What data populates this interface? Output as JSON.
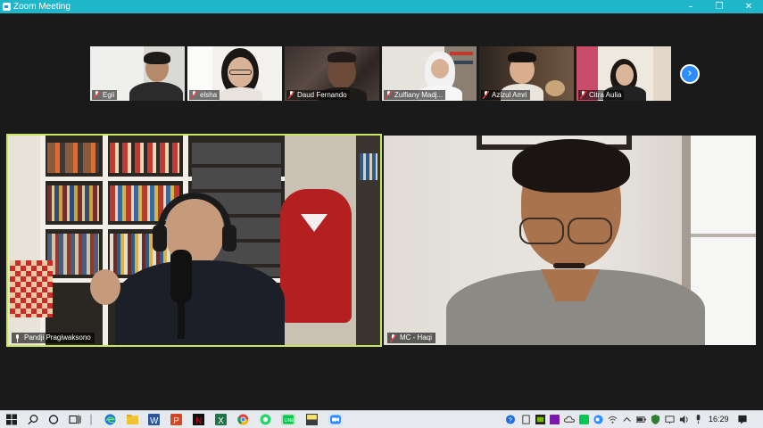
{
  "window": {
    "title": "Zoom Meeting",
    "title_bar_color": "#20b6c9",
    "controls": {
      "minimize": "–",
      "maximize": "❐",
      "close": "✕"
    }
  },
  "gallery": {
    "participants": [
      {
        "name": "Egii",
        "muted": true
      },
      {
        "name": "elsha",
        "muted": true
      },
      {
        "name": "Daud Fernando",
        "muted": true
      },
      {
        "name": "Zulfiany Madj...",
        "muted": true
      },
      {
        "name": "Azizul Amri",
        "muted": true
      },
      {
        "name": "Citra Aulia",
        "muted": true
      }
    ],
    "next_icon": "chevron-right"
  },
  "speakers": [
    {
      "name": "Pandji Pragiwaksono",
      "active_speaker": true,
      "highlight_color": "#c8e65a"
    },
    {
      "name": "MC - Haqi",
      "muted": true
    }
  ],
  "taskbar": {
    "apps": [
      "windows-start",
      "search",
      "cortana",
      "task-view",
      "file-explorer",
      "edge",
      "folder",
      "word",
      "powerpoint",
      "netflix",
      "excel",
      "chrome",
      "whatsapp",
      "line",
      "notes",
      "zoom"
    ],
    "clock": "16:29"
  }
}
